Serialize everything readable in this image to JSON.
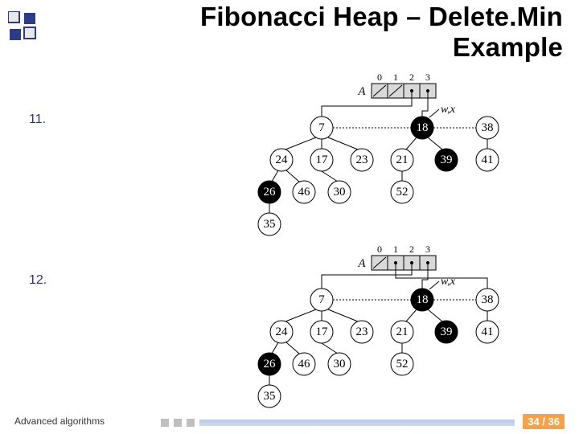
{
  "title": "Fibonacci Heap – Delete.Min Example",
  "steps": {
    "s11": "11.",
    "s12": "12."
  },
  "array": {
    "label": "A",
    "indices": [
      "0",
      "1",
      "2",
      "3"
    ],
    "annot": "w,x",
    "slashes11": [
      true,
      true,
      false,
      false
    ],
    "slashes12": [
      true,
      false,
      false,
      false
    ]
  },
  "nodes": {
    "n7": "7",
    "n24": "24",
    "n17": "17",
    "n23": "23",
    "n26": "26",
    "n46": "46",
    "n30": "30",
    "n35": "35",
    "n18": "18",
    "n21": "21",
    "n39": "39",
    "n52": "52",
    "n38": "38",
    "n41": "41"
  },
  "chart_data": {
    "type": "table",
    "description": "Two states (11 and 12) of a Fibonacci heap during consolidate after extract-min. Root list nodes: 7, 18, 38 (linked). Array A has 4 slots indexed 0..3; in state 11 slots 0 and 1 are empty (slashed), slots 2 and 3 point to 7 and 18; in state 12 slot 0 is empty, slots 1,2,3 point to 38,7,18. Marked (black) nodes: 18, 26, 39. Children: 7→24,17,23; 24→26,46; 17→30; 26→35; 18→21,39; 21→52; 38→41.",
    "states": [
      {
        "id": 11,
        "roots": [
          7,
          18,
          38
        ],
        "A": [
          null,
          null,
          7,
          18
        ],
        "pointer_vars": [
          "w",
          "x"
        ],
        "pointer_target": 18
      },
      {
        "id": 12,
        "roots": [
          7,
          18,
          38
        ],
        "A": [
          null,
          38,
          7,
          18
        ],
        "pointer_vars": [
          "w",
          "x"
        ],
        "pointer_target": 18
      }
    ],
    "tree": {
      "7": {
        "children": [
          24,
          17,
          23
        ],
        "marked": false
      },
      "24": {
        "children": [
          26,
          46
        ],
        "marked": false
      },
      "17": {
        "children": [
          30
        ],
        "marked": false
      },
      "23": {
        "children": [],
        "marked": false
      },
      "26": {
        "children": [
          35
        ],
        "marked": true
      },
      "46": {
        "children": [],
        "marked": false
      },
      "30": {
        "children": [],
        "marked": false
      },
      "35": {
        "children": [],
        "marked": false
      },
      "18": {
        "children": [
          21,
          39
        ],
        "marked": true
      },
      "21": {
        "children": [
          52
        ],
        "marked": false
      },
      "39": {
        "children": [],
        "marked": true
      },
      "52": {
        "children": [],
        "marked": false
      },
      "38": {
        "children": [
          41
        ],
        "marked": false
      },
      "41": {
        "children": [],
        "marked": false
      }
    }
  },
  "footer": {
    "label": "Advanced algorithms",
    "page": "34 / 36"
  }
}
